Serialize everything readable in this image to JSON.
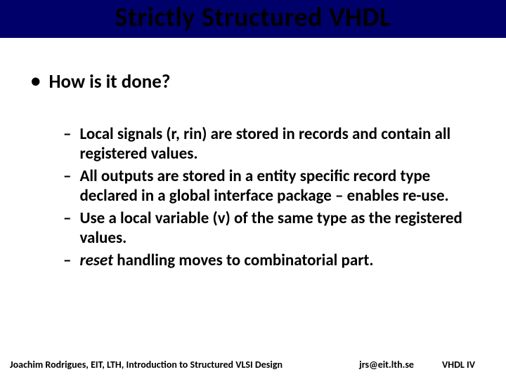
{
  "title": "Strictly Structured VHDL",
  "main_bullet": "How is it done?",
  "sub_bullets": [
    {
      "text": "Local signals (r, rin) are stored in records and contain all registered values."
    },
    {
      "text": "All outputs are stored in a entity specific record type declared in a global interface package – enables re-use."
    },
    {
      "text": "Use a local variable (v) of the same type as the registered values."
    },
    {
      "prefix_italic": "reset",
      "rest": " handling moves to combinatorial part."
    }
  ],
  "footer": {
    "left": "Joachim Rodrigues, EIT, LTH, Introduction to Structured VLSI Design",
    "center": "jrs@eit.lth.se",
    "right": "VHDL IV"
  }
}
